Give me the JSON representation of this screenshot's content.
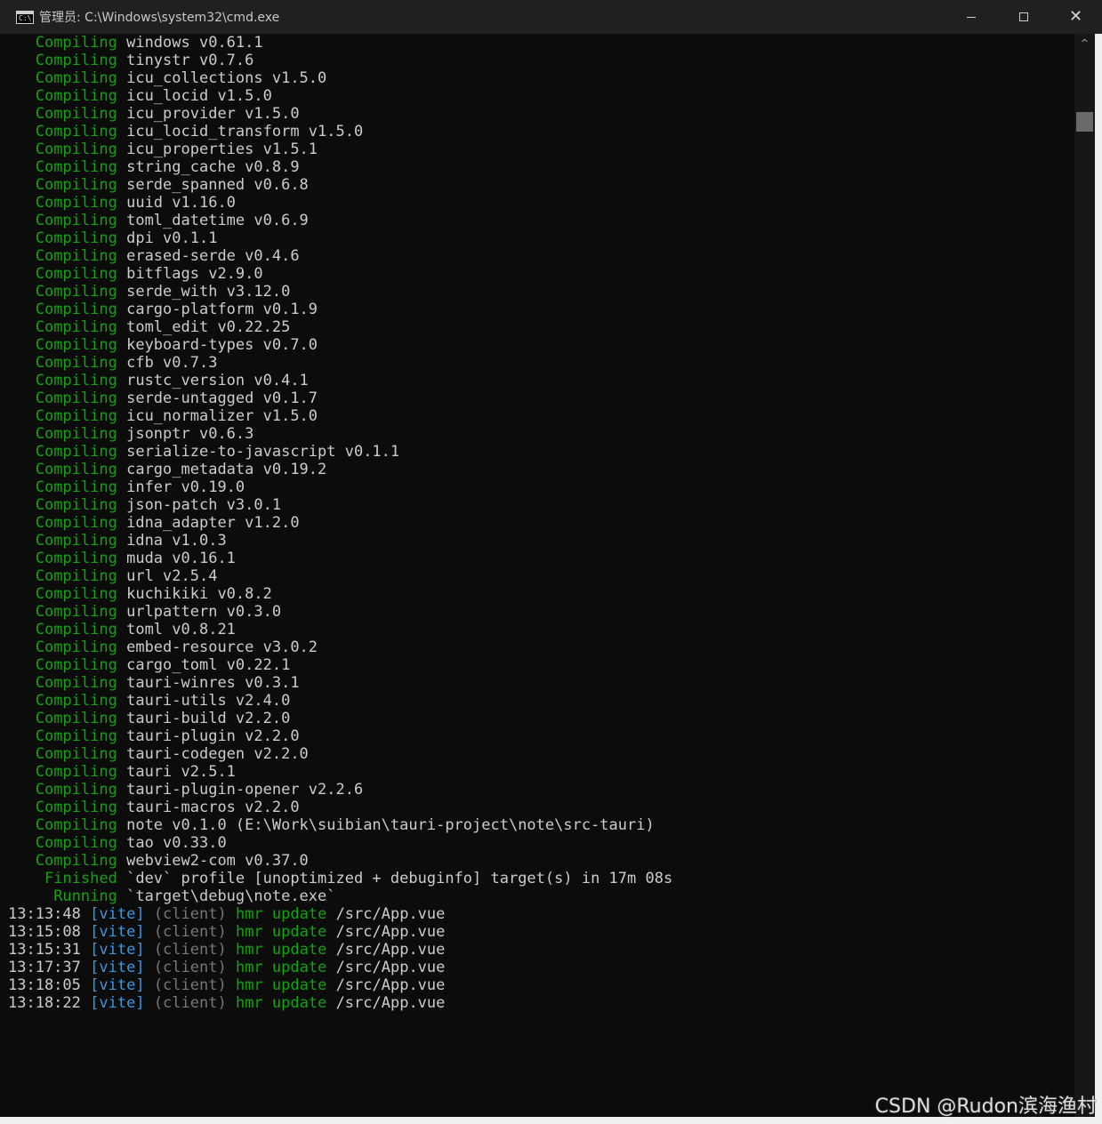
{
  "window": {
    "title": "管理员: C:\\Windows\\system32\\cmd.exe",
    "icon": "cmd-icon",
    "icon_text": "C:\\",
    "controls": {
      "minimize": "minimize-icon",
      "maximize": "maximize-icon",
      "close": "close-icon",
      "close_glyph": "✕"
    }
  },
  "console": {
    "compile_lines": [
      {
        "verb": "Compiling",
        "pkg": "windows v0.61.1"
      },
      {
        "verb": "Compiling",
        "pkg": "tinystr v0.7.6"
      },
      {
        "verb": "Compiling",
        "pkg": "icu_collections v1.5.0"
      },
      {
        "verb": "Compiling",
        "pkg": "icu_locid v1.5.0"
      },
      {
        "verb": "Compiling",
        "pkg": "icu_provider v1.5.0"
      },
      {
        "verb": "Compiling",
        "pkg": "icu_locid_transform v1.5.0"
      },
      {
        "verb": "Compiling",
        "pkg": "icu_properties v1.5.1"
      },
      {
        "verb": "Compiling",
        "pkg": "string_cache v0.8.9"
      },
      {
        "verb": "Compiling",
        "pkg": "serde_spanned v0.6.8"
      },
      {
        "verb": "Compiling",
        "pkg": "uuid v1.16.0"
      },
      {
        "verb": "Compiling",
        "pkg": "toml_datetime v0.6.9"
      },
      {
        "verb": "Compiling",
        "pkg": "dpi v0.1.1"
      },
      {
        "verb": "Compiling",
        "pkg": "erased-serde v0.4.6"
      },
      {
        "verb": "Compiling",
        "pkg": "bitflags v2.9.0"
      },
      {
        "verb": "Compiling",
        "pkg": "serde_with v3.12.0"
      },
      {
        "verb": "Compiling",
        "pkg": "cargo-platform v0.1.9"
      },
      {
        "verb": "Compiling",
        "pkg": "toml_edit v0.22.25"
      },
      {
        "verb": "Compiling",
        "pkg": "keyboard-types v0.7.0"
      },
      {
        "verb": "Compiling",
        "pkg": "cfb v0.7.3"
      },
      {
        "verb": "Compiling",
        "pkg": "rustc_version v0.4.1"
      },
      {
        "verb": "Compiling",
        "pkg": "serde-untagged v0.1.7"
      },
      {
        "verb": "Compiling",
        "pkg": "icu_normalizer v1.5.0"
      },
      {
        "verb": "Compiling",
        "pkg": "jsonptr v0.6.3"
      },
      {
        "verb": "Compiling",
        "pkg": "serialize-to-javascript v0.1.1"
      },
      {
        "verb": "Compiling",
        "pkg": "cargo_metadata v0.19.2"
      },
      {
        "verb": "Compiling",
        "pkg": "infer v0.19.0"
      },
      {
        "verb": "Compiling",
        "pkg": "json-patch v3.0.1"
      },
      {
        "verb": "Compiling",
        "pkg": "idna_adapter v1.2.0"
      },
      {
        "verb": "Compiling",
        "pkg": "idna v1.0.3"
      },
      {
        "verb": "Compiling",
        "pkg": "muda v0.16.1"
      },
      {
        "verb": "Compiling",
        "pkg": "url v2.5.4"
      },
      {
        "verb": "Compiling",
        "pkg": "kuchikiki v0.8.2"
      },
      {
        "verb": "Compiling",
        "pkg": "urlpattern v0.3.0"
      },
      {
        "verb": "Compiling",
        "pkg": "toml v0.8.21"
      },
      {
        "verb": "Compiling",
        "pkg": "embed-resource v3.0.2"
      },
      {
        "verb": "Compiling",
        "pkg": "cargo_toml v0.22.1"
      },
      {
        "verb": "Compiling",
        "pkg": "tauri-winres v0.3.1"
      },
      {
        "verb": "Compiling",
        "pkg": "tauri-utils v2.4.0"
      },
      {
        "verb": "Compiling",
        "pkg": "tauri-build v2.2.0"
      },
      {
        "verb": "Compiling",
        "pkg": "tauri-plugin v2.2.0"
      },
      {
        "verb": "Compiling",
        "pkg": "tauri-codegen v2.2.0"
      },
      {
        "verb": "Compiling",
        "pkg": "tauri v2.5.1"
      },
      {
        "verb": "Compiling",
        "pkg": "tauri-plugin-opener v2.2.6"
      },
      {
        "verb": "Compiling",
        "pkg": "tauri-macros v2.2.0"
      },
      {
        "verb": "Compiling",
        "pkg": "note v0.1.0 (E:\\Work\\suibian\\tauri-project\\note\\src-tauri)"
      },
      {
        "verb": "Compiling",
        "pkg": "tao v0.33.0"
      },
      {
        "verb": "Compiling",
        "pkg": "webview2-com v0.37.0"
      },
      {
        "verb": " Finished",
        "pkg": "`dev` profile [unoptimized + debuginfo] target(s) in 17m 08s"
      },
      {
        "verb": "  Running",
        "pkg": "`target\\debug\\note.exe`"
      }
    ],
    "hmr_lines": [
      {
        "time": "13:13:48",
        "tag": "[vite]",
        "client": "(client)",
        "action": "hmr update",
        "path": "/src/App.vue"
      },
      {
        "time": "13:15:08",
        "tag": "[vite]",
        "client": "(client)",
        "action": "hmr update",
        "path": "/src/App.vue"
      },
      {
        "time": "13:15:31",
        "tag": "[vite]",
        "client": "(client)",
        "action": "hmr update",
        "path": "/src/App.vue"
      },
      {
        "time": "13:17:37",
        "tag": "[vite]",
        "client": "(client)",
        "action": "hmr update",
        "path": "/src/App.vue"
      },
      {
        "time": "13:18:05",
        "tag": "[vite]",
        "client": "(client)",
        "action": "hmr update",
        "path": "/src/App.vue"
      },
      {
        "time": "13:18:22",
        "tag": "[vite]",
        "client": "(client)",
        "action": "hmr update",
        "path": "/src/App.vue"
      }
    ]
  },
  "scrollbar": {
    "up_arrow": "^"
  },
  "watermark": "CSDN @Rudon滨海渔村",
  "colors": {
    "background": "#0c0c0c",
    "text": "#cccccc",
    "compiling_green": "#13a10e",
    "vite_blue": "#3a96dd",
    "client_gray": "#767676",
    "titlebar": "#202020"
  }
}
